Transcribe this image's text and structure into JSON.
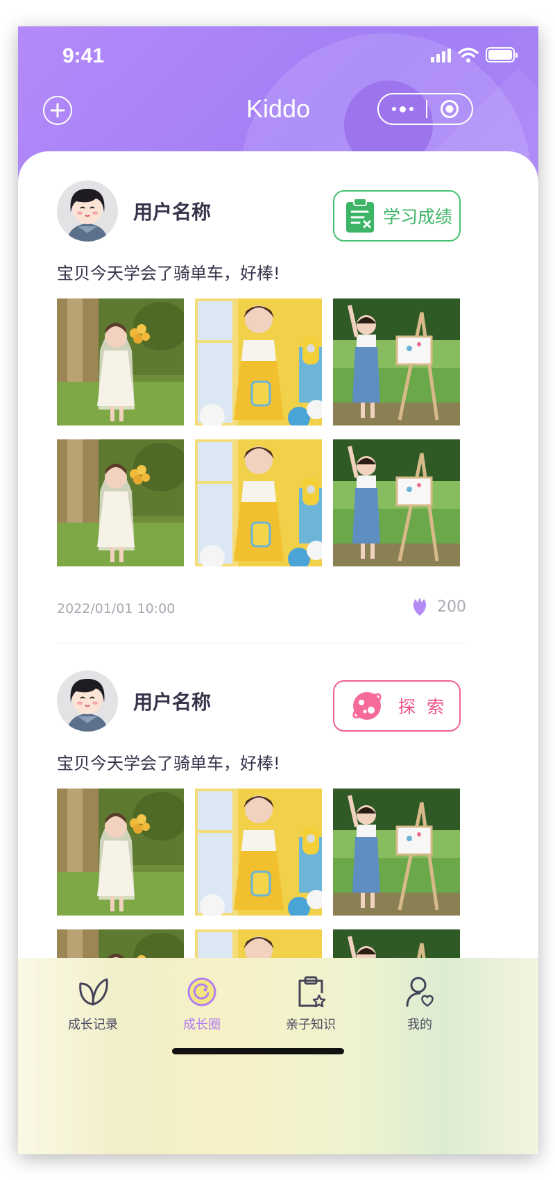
{
  "status_bar": {
    "time": "9:41"
  },
  "header": {
    "title": "Kiddo"
  },
  "colors": {
    "primary": "#a57ff7",
    "active_tab": "#b07ef3",
    "tag_green": "#3cb566",
    "tag_pink": "#ee4f84",
    "like": "#b48af5"
  },
  "posts": [
    {
      "username": "用户名称",
      "tag": {
        "label": "学习成绩",
        "icon": "report-icon",
        "color": "green"
      },
      "caption": "宝贝今天学会了骑单车，好棒!",
      "photos": [
        "girl-flowers-photo",
        "girl-yellow-dress-photo",
        "girl-painting-photo",
        "girl-flowers-photo",
        "girl-yellow-dress-photo",
        "girl-painting-photo"
      ],
      "timestamp": "2022/01/01 10:00",
      "likes": "200"
    },
    {
      "username": "用户名称",
      "tag": {
        "label": "探  索",
        "icon": "planet-icon",
        "color": "pink"
      },
      "caption": "宝贝今天学会了骑单车，好棒!",
      "photos": [
        "girl-flowers-photo",
        "girl-yellow-dress-photo",
        "girl-painting-photo",
        "girl-flowers-photo",
        "girl-yellow-dress-photo",
        "girl-painting-photo"
      ]
    }
  ],
  "tabbar": {
    "items": [
      {
        "label": "成长记录",
        "icon": "leaf-icon",
        "active": false
      },
      {
        "label": "成长圈",
        "icon": "circle-icon",
        "active": true
      },
      {
        "label": "亲子知识",
        "icon": "clipboard-star-icon",
        "active": false
      },
      {
        "label": "我的",
        "icon": "user-heart-icon",
        "active": false
      }
    ]
  }
}
